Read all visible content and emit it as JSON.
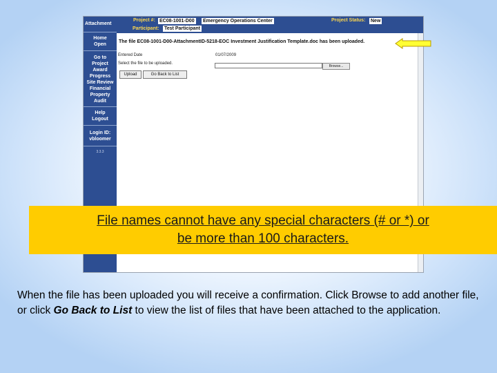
{
  "sidebar": {
    "header": "Attachment",
    "home": "Home",
    "open": "Open",
    "goto": [
      "Go to",
      "Project",
      "Award",
      "Progress",
      "Site Review",
      "Financial",
      "Property",
      "Audit"
    ],
    "help": "Help",
    "logout": "Logout",
    "login_label": "Login ID:",
    "login_id": "vbloomer",
    "version": "3.3.3"
  },
  "topbar": {
    "project_label": "Project #:",
    "project_number": "EC08-1001-D00",
    "project_name": "Emergency Operations Center",
    "status_label": "Project Status:",
    "status_value": "New",
    "participant_label": "Participant:",
    "participant_value": "Test Participant"
  },
  "content": {
    "message": "The file EC08-1001-D00-AttachmentID-5218-EOC Investment Justification Template.doc has been uploaded.",
    "entered_date_label": "Entered Date",
    "entered_date_value": "01/07/2009",
    "select_file_label": "Select the file to be uploaded.",
    "browse_label": "Browse...",
    "upload_label": "Upload",
    "back_label": "Go Back to List"
  },
  "callout": {
    "line1": "File names cannot have any special characters (# or *) or",
    "line2": "be more than 100 characters."
  },
  "caption": {
    "part1": "When the file has been uploaded you will receive a confirmation. Click Browse to add another file, or click ",
    "emphasis": "Go Back to List",
    "part2": " to view the list of files that have been attached to the application."
  },
  "colors": {
    "nav_blue": "#2d4e92",
    "label_yellow": "#ffd84d",
    "callout_yellow": "#ffcc00",
    "arrow_yellow": "#ffff33"
  }
}
